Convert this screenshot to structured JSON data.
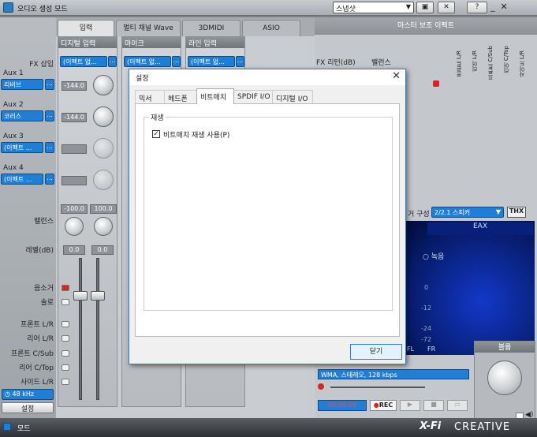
{
  "window": {
    "title": "오디오 생성 모드",
    "preset": "스냅샷",
    "mode_label": "모드",
    "brand": "CREATIVE",
    "brand_prefix": "X-Fi"
  },
  "left": {
    "fx_insert": "FX 삽입",
    "aux": [
      {
        "label": "Aux 1",
        "value": "리버브"
      },
      {
        "label": "Aux 2",
        "value": "코러스"
      },
      {
        "label": "Aux 3",
        "value": "(이펙트 ..."
      },
      {
        "label": "Aux 4",
        "value": "(이펙트 ..."
      }
    ],
    "balance": "밸런스",
    "level": "레벨(dB)",
    "mute": "음소거",
    "solo": "솔로",
    "routes": [
      "프론트 L/R",
      "리어 L/R",
      "프론트 C/Sub",
      "리어 C/Top",
      "사이드 L/R"
    ],
    "samplerate": "48 kHz",
    "settings": "설정"
  },
  "tabs": [
    "입력",
    "멀티 채널 Wave",
    "3DMIDI",
    "ASIO"
  ],
  "strips": [
    {
      "name": "디지털 입력",
      "fx": "(이펙트 없...",
      "lcd1": "-144.0",
      "lcd2": "-144.0",
      "bal_l": "-100.0",
      "bal_r": "100.0",
      "lvl_l": "0.0",
      "lvl_r": "0.0"
    },
    {
      "name": "마이크",
      "fx": "(이펙트 없..."
    },
    {
      "name": "라인 입력",
      "fx": "(이펙트 없..."
    }
  ],
  "right": {
    "master_title": "마스터 보조 이펙트",
    "fx_return": "FX 리턴(dB)",
    "balance": "밸런스",
    "col_labels": [
      "프론트 L/R",
      "리어 L/R",
      "프론트 C/Sub",
      "리어 C/Top",
      "사이드 L/R"
    ],
    "speaker_label": "거 구성",
    "speaker_value": "2/2.1 스피커",
    "thx": "THX",
    "eax": "EAX",
    "record_label": "녹음",
    "meter_vals": [
      "0",
      "-12",
      "-24",
      "-72"
    ],
    "fl": "FL",
    "fr": "FR",
    "format": "WMA, 스테레오, 128 kbps",
    "rec_time": "00:00:00",
    "rec_btn": "REC",
    "volume": "볼륨"
  },
  "dialog": {
    "title": "설정",
    "tabs": [
      "믹서",
      "헤드폰",
      "비트매치",
      "SPDIF I/O",
      "디지털 I/O"
    ],
    "active_tab": 2,
    "group": "재생",
    "checkbox_label": "비트매치 재생 사용(P)",
    "checked": true,
    "close_button": "닫기"
  }
}
